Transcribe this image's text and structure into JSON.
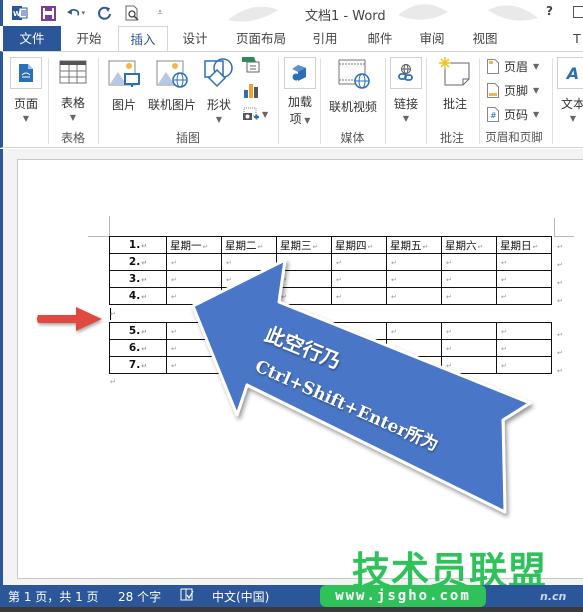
{
  "window": {
    "title": "文档1 - Word",
    "help": "?"
  },
  "quick_access": {
    "icons": [
      "word-logo-icon",
      "save-icon",
      "undo-icon",
      "redo-icon",
      "print-preview-icon",
      "customize-qat-icon"
    ]
  },
  "tabs": [
    {
      "label": "文件",
      "kind": "file"
    },
    {
      "label": "开始"
    },
    {
      "label": "插入",
      "active": true
    },
    {
      "label": "设计"
    },
    {
      "label": "页面布局"
    },
    {
      "label": "引用"
    },
    {
      "label": "邮件"
    },
    {
      "label": "审阅"
    },
    {
      "label": "视图"
    },
    {
      "label": "T"
    }
  ],
  "ribbon": {
    "pages": {
      "label": "页面"
    },
    "table": {
      "label": "表格",
      "group": "表格"
    },
    "illustrations": {
      "group": "插图",
      "picture": "图片",
      "online_picture": "联机图片",
      "shapes": "形状"
    },
    "addins": {
      "label1": "加载",
      "label2": "项"
    },
    "media": {
      "group": "媒体",
      "online_video": "联机视频"
    },
    "links": {
      "label": "链接"
    },
    "comments": {
      "group": "批注",
      "comment": "批注"
    },
    "header_footer": {
      "group": "页眉和页脚",
      "header": "页眉",
      "footer": "页脚",
      "page_number": "页码"
    },
    "text": {
      "label": "文本"
    }
  },
  "document": {
    "table": {
      "header": [
        "1.",
        "星期一",
        "星期二",
        "星期三",
        "星期四",
        "星期五",
        "星期六",
        "星期日"
      ],
      "rows_top": [
        "2.",
        "3.",
        "4."
      ],
      "rows_bottom": [
        "5.",
        "6.",
        "7."
      ]
    },
    "annotation": {
      "line1": "此空行乃",
      "line2": "Ctrl+Shift+Enter所为"
    },
    "colors": {
      "arrow_blue": "#4472c4",
      "arrow_red": "#e04a3f"
    }
  },
  "statusbar": {
    "page": "第 1 页，共 1 页",
    "words": "28 个字",
    "language": "中文(中国)"
  },
  "watermark": {
    "title": "技术员联盟",
    "url": "www.jsgho.com",
    "suffix": "n.cn",
    "color": "#2fc25b"
  }
}
